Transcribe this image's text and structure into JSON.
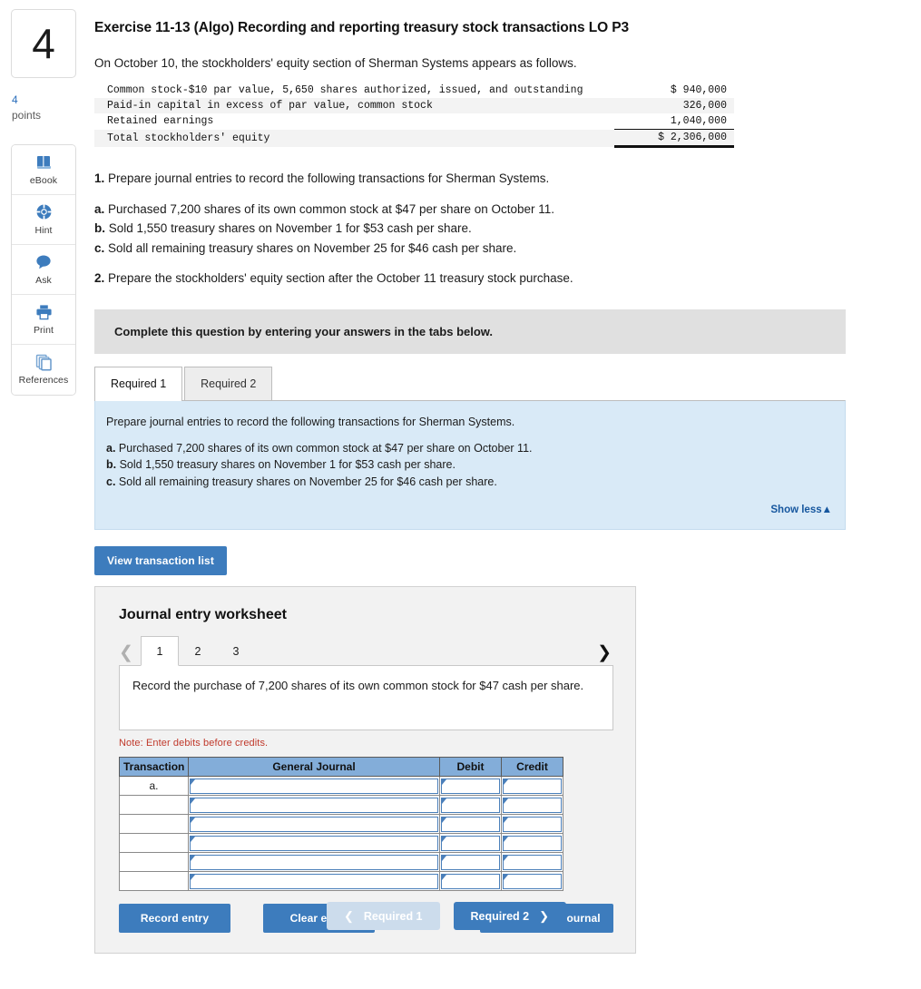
{
  "question": {
    "number": "4",
    "points_value": "4",
    "points_label": "points",
    "title": "Exercise 11-13 (Algo) Recording and reporting treasury stock transactions LO P3",
    "intro": "On October 10, the stockholders' equity section of Sherman Systems appears as follows."
  },
  "tools": [
    {
      "label": "eBook",
      "icon": "book-icon"
    },
    {
      "label": "Hint",
      "icon": "lifebuoy-icon"
    },
    {
      "label": "Ask",
      "icon": "speech-bubble-icon"
    },
    {
      "label": "Print",
      "icon": "printer-icon"
    },
    {
      "label": "References",
      "icon": "copy-stack-icon"
    }
  ],
  "equity_table": {
    "rows": [
      {
        "label": "Common stock-$10 par value, 5,650 shares authorized, issued, and outstanding",
        "amount": "$ 940,000"
      },
      {
        "label": "Paid-in capital in excess of par value, common stock",
        "amount": "326,000"
      },
      {
        "label": "Retained earnings",
        "amount": "1,040,000"
      },
      {
        "label": "Total stockholders' equity",
        "amount": "$ 2,306,000"
      }
    ]
  },
  "requirements": {
    "item1": "Prepare journal entries to record the following transactions for Sherman Systems.",
    "item1_num": "1.",
    "item2": "Prepare the stockholders' equity section after the October 11 treasury stock purchase.",
    "item2_num": "2.",
    "transactions": [
      {
        "letter": "a.",
        "text": "Purchased 7,200 shares of its own common stock at $47 per share on October 11."
      },
      {
        "letter": "b.",
        "text": "Sold 1,550 treasury shares on November 1 for $53 cash per share."
      },
      {
        "letter": "c.",
        "text": "Sold all remaining treasury shares on November 25 for $46 cash per share."
      }
    ]
  },
  "instruction_bar": "Complete this question by entering your answers in the tabs below.",
  "tabs": [
    {
      "label": "Required 1",
      "active": true
    },
    {
      "label": "Required 2",
      "active": false
    }
  ],
  "blue_panel": {
    "heading": "Prepare journal entries to record the following transactions for Sherman Systems.",
    "transactions": [
      {
        "letter": "a.",
        "text": "Purchased 7,200 shares of its own common stock at $47 per share on October 11."
      },
      {
        "letter": "b.",
        "text": "Sold 1,550 treasury shares on November 1 for $53 cash per share."
      },
      {
        "letter": "c.",
        "text": "Sold all remaining treasury shares on November 25 for $46 cash per share."
      }
    ],
    "show_less": "Show less▲"
  },
  "view_transaction_list_label": "View transaction list",
  "worksheet": {
    "title": "Journal entry worksheet",
    "pages": [
      "1",
      "2",
      "3"
    ],
    "active_page": "1",
    "prev_arrow": "❮",
    "next_arrow": "❯",
    "record_prompt": "Record the purchase of 7,200 shares of its own common stock for $47 cash per share.",
    "note": "Note: Enter debits before credits.",
    "table": {
      "headers": [
        "Transaction",
        "General Journal",
        "Debit",
        "Credit"
      ],
      "rows": [
        {
          "transaction": "a.",
          "general_journal": "",
          "debit": "",
          "credit": ""
        },
        {
          "transaction": "",
          "general_journal": "",
          "debit": "",
          "credit": ""
        },
        {
          "transaction": "",
          "general_journal": "",
          "debit": "",
          "credit": ""
        },
        {
          "transaction": "",
          "general_journal": "",
          "debit": "",
          "credit": ""
        },
        {
          "transaction": "",
          "general_journal": "",
          "debit": "",
          "credit": ""
        },
        {
          "transaction": "",
          "general_journal": "",
          "debit": "",
          "credit": ""
        }
      ]
    },
    "buttons": {
      "record_entry": "Record entry",
      "clear_entry": "Clear entry",
      "view_general_journal": "View general journal"
    }
  },
  "footer_nav": {
    "prev_label": "Required 1",
    "prev_arrow": "❮",
    "next_label": "Required 2",
    "next_arrow": "❯"
  },
  "colors": {
    "accent_blue": "#3d7cbd",
    "panel_blue": "#d9eaf7",
    "table_header_blue": "#83add9",
    "note_red": "#c0392b",
    "link_blue": "#15569e",
    "disabled_blue": "#ccdcec"
  }
}
